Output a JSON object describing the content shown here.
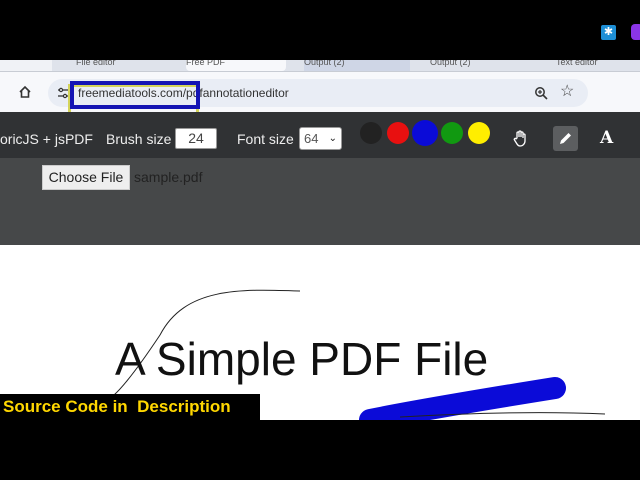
{
  "browser": {
    "tabs": [
      "File editor",
      "Free PDF",
      "Output (2)",
      "Output (2)",
      "Text editor"
    ],
    "url": "freemediatools.com/pdfannotationeditor"
  },
  "toolbar": {
    "app_label": "oricJS + jsPDF",
    "brush_label": "Brush size",
    "brush_value": "24",
    "font_label": "Font size",
    "font_value": "64",
    "colors": [
      "#222222",
      "#e81010",
      "#0b0bd8",
      "#119911",
      "#ffee00"
    ]
  },
  "filebar": {
    "choose_label": "Choose File",
    "file_name": "sample.pdf"
  },
  "pdf": {
    "title": "A Simple PDF File"
  },
  "caption": "Source Code in  Description"
}
